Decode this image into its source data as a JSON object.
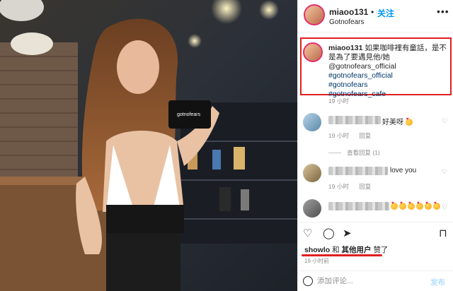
{
  "header": {
    "username": "miaoo131",
    "separator": "•",
    "follow_label": "关注",
    "location": "Gotnofears",
    "more_icon": "more-horizontal-icon"
  },
  "caption": {
    "username": "miaoo131",
    "text": "如果咖啡裡有童話，是不是為了要遇見他/她@gotnofears_official",
    "hashtags": [
      "#gotnofears_official",
      "#gotnofears",
      "#gotnofears_cafe"
    ],
    "time": "19 小时"
  },
  "comments": [
    {
      "text": "好美呀",
      "emoji_count": 1,
      "time": "19 小时",
      "reply_label": "回复",
      "view_replies": "查看回复 (1)"
    },
    {
      "text": "love you",
      "emoji_count": 0,
      "time": "19 小时",
      "reply_label": "回复",
      "view_replies": ""
    },
    {
      "text": "",
      "emoji_count": 6,
      "time": "",
      "reply_label": "",
      "view_replies": ""
    }
  ],
  "likes": {
    "user": "showlo",
    "and": "和",
    "others": "其他用户",
    "suffix": "赞了"
  },
  "post_time": "19 小时前",
  "add_comment": {
    "placeholder": "添加评论...",
    "post_label": "发布"
  },
  "colors": {
    "follow_blue": "#0095f6",
    "highlight_red": "#e02020",
    "text": "#262626",
    "muted": "#8e8e8e"
  }
}
